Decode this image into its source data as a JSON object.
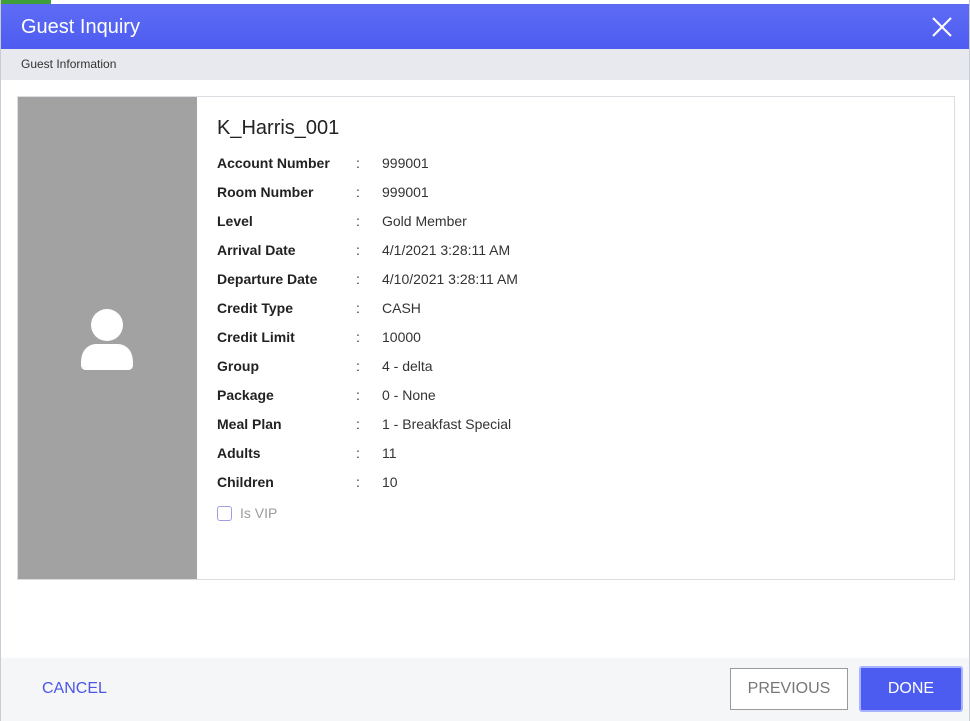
{
  "window": {
    "title": "Guest Inquiry",
    "subtitle": "Guest Information"
  },
  "guest": {
    "name": "K_Harris_001",
    "fields": [
      {
        "label": "Account Number",
        "value": "999001"
      },
      {
        "label": "Room Number",
        "value": "999001"
      },
      {
        "label": "Level",
        "value": "Gold Member"
      },
      {
        "label": "Arrival Date",
        "value": "4/1/2021 3:28:11 AM"
      },
      {
        "label": "Departure Date",
        "value": "4/10/2021 3:28:11 AM"
      },
      {
        "label": "Credit Type",
        "value": "CASH"
      },
      {
        "label": "Credit Limit",
        "value": "10000"
      },
      {
        "label": "Group",
        "value": "4 - delta"
      },
      {
        "label": "Package",
        "value": "0 - None"
      },
      {
        "label": "Meal Plan",
        "value": "1 - Breakfast Special"
      },
      {
        "label": "Adults",
        "value": "11"
      },
      {
        "label": "Children",
        "value": "10"
      }
    ],
    "separator": ":",
    "vip_label": "Is VIP",
    "vip_checked": false
  },
  "footer": {
    "cancel_label": "CANCEL",
    "previous_label": "PREVIOUS",
    "done_label": "DONE"
  },
  "icons": {
    "close": "close-icon",
    "avatar": "user-avatar-icon"
  },
  "colors": {
    "accent": "#4d5cf0",
    "header": "#5563f2",
    "avatar_bg": "#a2a2a2",
    "link": "#4b55e6"
  }
}
